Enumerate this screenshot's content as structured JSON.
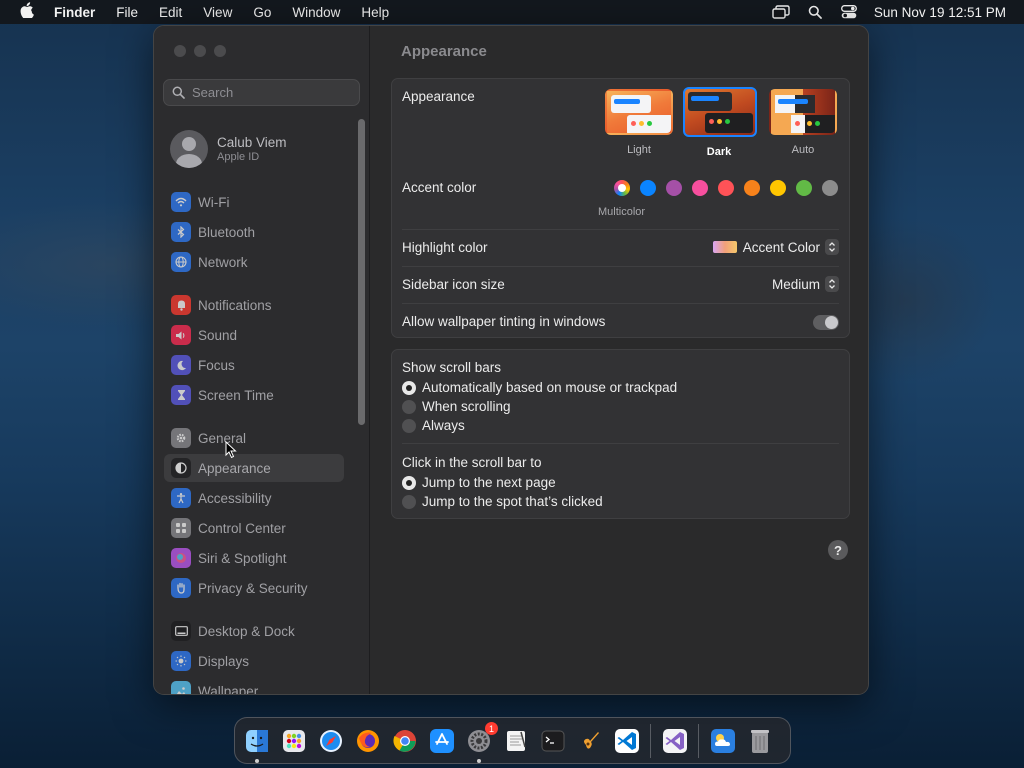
{
  "menubar": {
    "app_name": "Finder",
    "menus": [
      "File",
      "Edit",
      "View",
      "Go",
      "Window",
      "Help"
    ],
    "clock": "Sun Nov 19  12:51 PM"
  },
  "sidebar": {
    "search_placeholder": "Search",
    "account": {
      "name": "Calub Viem",
      "subtitle": "Apple ID"
    },
    "items": [
      {
        "label": "Wi-Fi",
        "icon": "wifi-icon",
        "color": "#2f7df6"
      },
      {
        "label": "Bluetooth",
        "icon": "bluetooth-icon",
        "color": "#2f7df6"
      },
      {
        "label": "Network",
        "icon": "globe-icon",
        "color": "#2f7df6"
      },
      {
        "label": "Notifications",
        "icon": "bell-icon",
        "color": "#ff3b30"
      },
      {
        "label": "Sound",
        "icon": "speaker-icon",
        "color": "#ff2d55"
      },
      {
        "label": "Focus",
        "icon": "moon-icon",
        "color": "#5e5ce6"
      },
      {
        "label": "Screen Time",
        "icon": "hourglass-icon",
        "color": "#5e5ce6"
      },
      {
        "label": "General",
        "icon": "gear-icon",
        "color": "#8e8e93"
      },
      {
        "label": "Appearance",
        "icon": "appearance-icon",
        "color": "#1c1c1e"
      },
      {
        "label": "Accessibility",
        "icon": "accessibility-icon",
        "color": "#2f7df6"
      },
      {
        "label": "Control Center",
        "icon": "control-center-icon",
        "color": "#8e8e93"
      },
      {
        "label": "Siri & Spotlight",
        "icon": "siri-icon",
        "color": "#bf5af2"
      },
      {
        "label": "Privacy & Security",
        "icon": "hand-icon",
        "color": "#2f7df6"
      },
      {
        "label": "Desktop & Dock",
        "icon": "desktop-icon",
        "color": "#1c1c1e"
      },
      {
        "label": "Displays",
        "icon": "sun-icon",
        "color": "#2f7df6"
      },
      {
        "label": "Wallpaper",
        "icon": "wallpaper-icon",
        "color": "#5ac8fa"
      }
    ]
  },
  "main": {
    "title": "Appearance",
    "appearance": {
      "label": "Appearance",
      "options": [
        {
          "label": "Light",
          "selected": false
        },
        {
          "label": "Dark",
          "selected": true
        },
        {
          "label": "Auto",
          "selected": false
        }
      ]
    },
    "accent": {
      "label": "Accent color",
      "multicolor_label": "Multicolor",
      "colors": [
        "multicolor",
        "#0a84ff",
        "#a550a7",
        "#f74f9e",
        "#ff5257",
        "#f7821b",
        "#ffc600",
        "#62ba46",
        "#8c8c8c"
      ]
    },
    "highlight": {
      "label": "Highlight color",
      "value": "Accent Color"
    },
    "sidebar_icon_size": {
      "label": "Sidebar icon size",
      "value": "Medium"
    },
    "wallpaper_tinting": {
      "label": "Allow wallpaper tinting in windows",
      "enabled": false
    },
    "scroll_bars": {
      "label": "Show scroll bars",
      "options": [
        {
          "label": "Automatically based on mouse or trackpad",
          "selected": true
        },
        {
          "label": "When scrolling",
          "selected": false
        },
        {
          "label": "Always",
          "selected": false
        }
      ]
    },
    "click_scroll": {
      "label": "Click in the scroll bar to",
      "options": [
        {
          "label": "Jump to the next page",
          "selected": true
        },
        {
          "label": "Jump to the spot that’s clicked",
          "selected": false
        }
      ]
    },
    "help": "?"
  },
  "dock": {
    "apps": [
      {
        "name": "finder-icon",
        "color": "#3a8ee6",
        "running": true
      },
      {
        "name": "launchpad-icon",
        "color": "#d9d9de",
        "running": false
      },
      {
        "name": "safari-icon",
        "color": "#1e8cf0",
        "running": false
      },
      {
        "name": "firefox-icon",
        "color": "#ff6f1a",
        "running": false
      },
      {
        "name": "chrome-icon",
        "color": "#e8e8e8",
        "running": false
      },
      {
        "name": "app-store-icon",
        "color": "#1e90ff",
        "running": false
      },
      {
        "name": "system-settings-icon",
        "color": "#8e8e93",
        "running": true,
        "badge": "1"
      },
      {
        "name": "textedit-icon",
        "color": "#f0f0f0",
        "running": false
      },
      {
        "name": "terminal-icon",
        "color": "#1c1c1e",
        "running": false
      },
      {
        "name": "garageband-icon",
        "color": "#f0a030",
        "running": false
      },
      {
        "name": "vscode-icon",
        "color": "#ffffff",
        "running": false
      },
      {
        "name": "visual-studio-icon",
        "color": "#f0f0f0",
        "running": false
      },
      {
        "name": "weather-icon",
        "color": "#2a7fe0",
        "running": false
      },
      {
        "name": "trash-icon",
        "color": "#6e6e72",
        "running": false
      }
    ]
  }
}
